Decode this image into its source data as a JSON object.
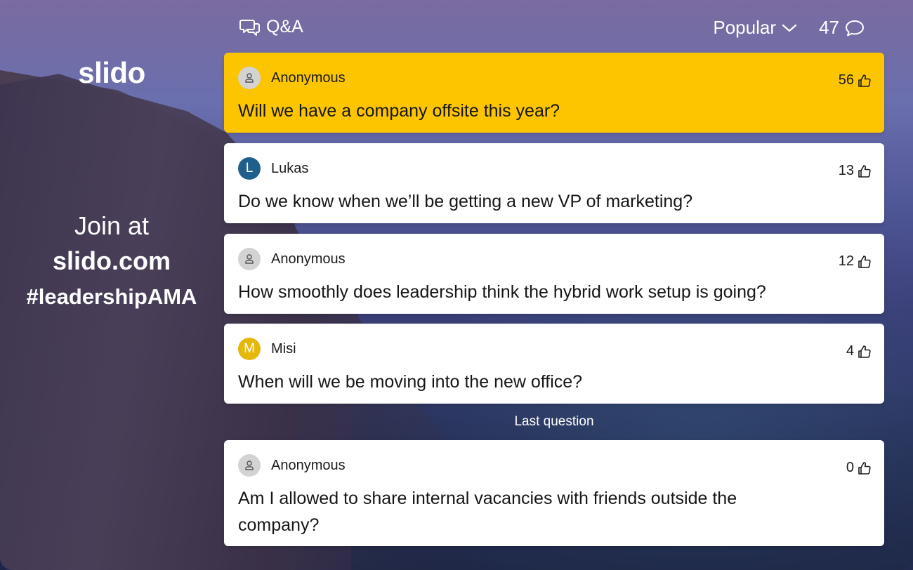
{
  "left": {
    "logo": "slido",
    "join_line1": "Join at",
    "join_line2": "slido.com",
    "join_line3": "#leadershipAMA"
  },
  "header": {
    "tab_label": "Q&A",
    "sort_label": "Popular",
    "question_count": "47"
  },
  "questions": [
    {
      "author": "Anonymous",
      "avatar_letter": "",
      "avatar_color": "#d3d3d3",
      "text": "Will we have a company offsite this year?",
      "votes": "56",
      "highlighted": true
    },
    {
      "author": "Lukas",
      "avatar_letter": "L",
      "avatar_color": "#1f5f8b",
      "text": "Do we know when we’ll be getting a new VP of marketing?",
      "votes": "13"
    },
    {
      "author": "Anonymous",
      "avatar_letter": "",
      "avatar_color": "#d3d3d3",
      "text": "How smoothly does leadership think the hybrid work setup is going?",
      "votes": "12"
    },
    {
      "author": "Misi",
      "avatar_letter": "M",
      "avatar_color": "#e6b70b",
      "text": "When will we be moving into the new office?",
      "votes": "4"
    },
    {
      "author": "Anonymous",
      "avatar_letter": "",
      "avatar_color": "#d3d3d3",
      "text": "Am I allowed to share internal vacancies with friends outside the company?",
      "votes": "0"
    }
  ],
  "last_question_label": "Last question",
  "colors": {
    "highlight": "#fdc500",
    "card": "#ffffff"
  },
  "icons": {
    "tab": "speech-bubbles-icon",
    "sort": "chevron-down-icon",
    "count": "comment-icon",
    "vote": "thumbs-up-icon",
    "anonymous": "person-icon"
  }
}
